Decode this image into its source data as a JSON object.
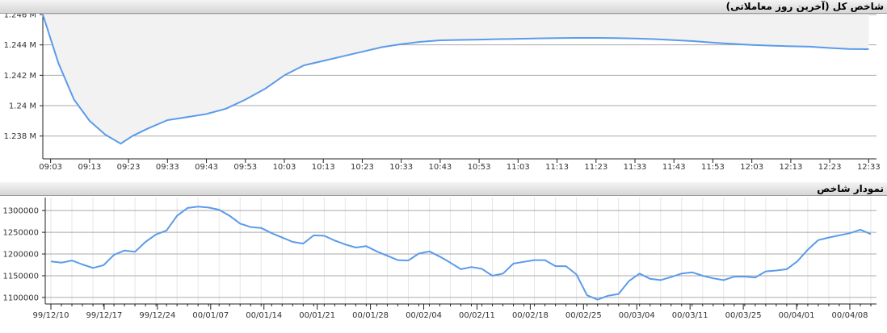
{
  "panels": {
    "top_title": "شاخص کل (آخرین روز معاملاتی)",
    "bottom_title": "نمودار شاخص"
  },
  "colors": {
    "line": "#5b9bea",
    "area_fill": "#f2f2f2",
    "grid_major": "#aaaaaa",
    "grid_minor": "#e6e6e6",
    "axis": "#222222"
  },
  "chart_data": [
    {
      "type": "area",
      "title": "شاخص کل (آخرین روز معاملاتی)",
      "xlabel": "",
      "ylabel": "",
      "ylim": [
        1236500,
        1246000
      ],
      "y_ticks": [
        1238000,
        1240000,
        1242000,
        1244000,
        1246000
      ],
      "y_tick_labels": [
        "1.238 M",
        "1.24 M",
        "1.242 M",
        "1.244 M",
        "1.246 M"
      ],
      "x_ticks": [
        "09:03",
        "09:13",
        "09:23",
        "09:33",
        "09:43",
        "09:53",
        "10:03",
        "10:13",
        "10:23",
        "10:33",
        "10:43",
        "10:53",
        "11:03",
        "11:13",
        "11:23",
        "11:33",
        "11:43",
        "11:53",
        "12:03",
        "12:13",
        "12:23",
        "12:33"
      ],
      "grid": "horizontal",
      "baseline": 1246000,
      "x": [
        "09:01",
        "09:05",
        "09:09",
        "09:13",
        "09:17",
        "09:21",
        "09:24",
        "09:28",
        "09:33",
        "09:38",
        "09:43",
        "09:48",
        "09:53",
        "09:58",
        "10:03",
        "10:08",
        "10:13",
        "10:18",
        "10:23",
        "10:28",
        "10:33",
        "10:38",
        "10:43",
        "10:48",
        "10:53",
        "10:58",
        "11:03",
        "11:08",
        "11:13",
        "11:18",
        "11:23",
        "11:28",
        "11:33",
        "11:38",
        "11:43",
        "11:48",
        "11:53",
        "11:58",
        "12:03",
        "12:08",
        "12:13",
        "12:18",
        "12:23",
        "12:28",
        "12:33"
      ],
      "values": [
        1246000,
        1242800,
        1240400,
        1239000,
        1238100,
        1237500,
        1238000,
        1238500,
        1239050,
        1239250,
        1239450,
        1239800,
        1240400,
        1241100,
        1242000,
        1242650,
        1242950,
        1243250,
        1243550,
        1243850,
        1244050,
        1244200,
        1244300,
        1244330,
        1244350,
        1244380,
        1244400,
        1244430,
        1244450,
        1244460,
        1244460,
        1244450,
        1244420,
        1244380,
        1244320,
        1244250,
        1244150,
        1244070,
        1244000,
        1243950,
        1243910,
        1243880,
        1243800,
        1243730,
        1243720
      ]
    },
    {
      "type": "line",
      "title": "نمودار شاخص",
      "xlabel": "",
      "ylabel": "",
      "ylim": [
        1085000,
        1330000
      ],
      "y_ticks": [
        1100000,
        1150000,
        1200000,
        1250000,
        1300000
      ],
      "y_tick_labels": [
        "1100000",
        "1150000",
        "1200000",
        "1250000",
        "1300000"
      ],
      "x_tick_labels": [
        "99/12/10",
        "99/12/17",
        "99/12/24",
        "00/01/07",
        "00/01/14",
        "00/01/21",
        "00/01/28",
        "00/02/04",
        "00/02/11",
        "00/02/18",
        "00/02/25",
        "00/03/04",
        "00/03/11",
        "00/03/25",
        "00/04/01",
        "00/04/08"
      ],
      "grid": "both",
      "values": [
        1183000,
        1180000,
        1185000,
        1176000,
        1168000,
        1174000,
        1198000,
        1208000,
        1205000,
        1228000,
        1245000,
        1254000,
        1288000,
        1306000,
        1309000,
        1307000,
        1302000,
        1288000,
        1270000,
        1262000,
        1260000,
        1248000,
        1238000,
        1228000,
        1224000,
        1243000,
        1242000,
        1231000,
        1222000,
        1215000,
        1218000,
        1206000,
        1196000,
        1186000,
        1185000,
        1201000,
        1206000,
        1194000,
        1180000,
        1165000,
        1170000,
        1166000,
        1150000,
        1155000,
        1178000,
        1182000,
        1186000,
        1186000,
        1172000,
        1172000,
        1153000,
        1105000,
        1095000,
        1104000,
        1108000,
        1138000,
        1155000,
        1143000,
        1140000,
        1147000,
        1155000,
        1158000,
        1150000,
        1144000,
        1140000,
        1148000,
        1148000,
        1146000,
        1160000,
        1162000,
        1165000,
        1183000,
        1210000,
        1232000,
        1238000,
        1243000,
        1248000,
        1256000,
        1246000
      ]
    }
  ]
}
